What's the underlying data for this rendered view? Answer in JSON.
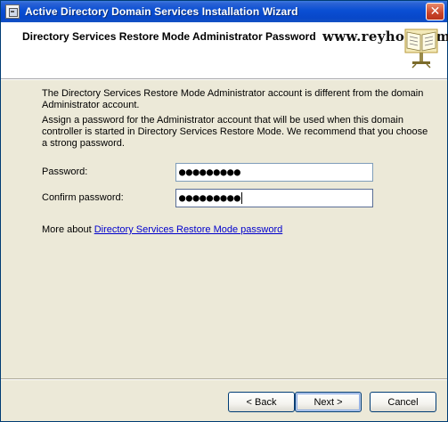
{
  "window": {
    "title": "Active Directory Domain Services Installation Wizard",
    "close_glyph": "✕"
  },
  "header": {
    "title": "Directory Services Restore Mode Administrator Password",
    "watermark": "www.reyhoo.com",
    "logo_icon": "book-on-stand-icon"
  },
  "body": {
    "paragraph1": "The Directory Services Restore Mode Administrator account is different from the domain Administrator account.",
    "paragraph2": "Assign a password for the Administrator account that will be used when this domain controller is started in Directory Services Restore Mode. We recommend that you choose a strong password.",
    "password_label": "Password:",
    "password_value": "●●●●●●●●●",
    "confirm_label": "Confirm password:",
    "confirm_value": "●●●●●●●●●",
    "more_prefix": "More about ",
    "more_link": "Directory Services Restore Mode password"
  },
  "buttons": {
    "back": "< Back",
    "next": "Next >",
    "cancel": "Cancel"
  },
  "colors": {
    "titlebar": "#0a4fd3",
    "window_bg": "#ece9d8",
    "link": "#0000cc"
  }
}
